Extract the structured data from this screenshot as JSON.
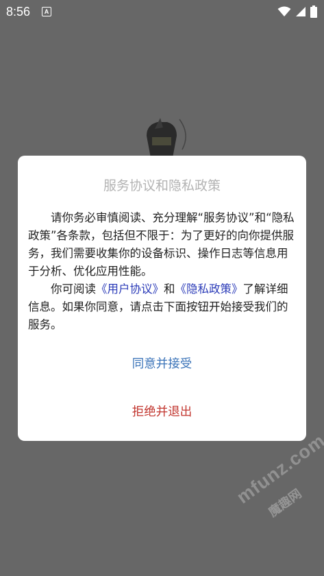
{
  "status_bar": {
    "time": "8:56",
    "notification_letter": "A",
    "icons": [
      "wifi-icon",
      "cellular-signal-icon",
      "battery-icon"
    ]
  },
  "dialog": {
    "title": "服务协议和隐私政策",
    "paragraph1": "请你务必审慎阅读、充分理解“服务协议”和“隐私政策”各条款，包括但不限于：为了更好的向你提供服务，我们需要收集你的设备标识、操作日志等信息用于分析、优化应用性能。",
    "paragraph2_prefix": "你可阅读",
    "user_agreement_link": "《用户协议》",
    "paragraph2_and": "和",
    "privacy_policy_link": "《隐私政策》",
    "paragraph2_suffix": "了解详细信息。如果你同意，请点击下面按钮开始接受我们的服务。",
    "accept_button": "同意并接受",
    "reject_button": "拒绝并退出"
  },
  "watermark": {
    "latin": "mfunz.com",
    "chinese": "魔趣网"
  },
  "colors": {
    "scrim": "#676767",
    "dialog_bg": "#ffffff",
    "title": "#b3b3b3",
    "link": "#2b3bb8",
    "accept": "#3a73b8",
    "reject": "#c2362f"
  }
}
